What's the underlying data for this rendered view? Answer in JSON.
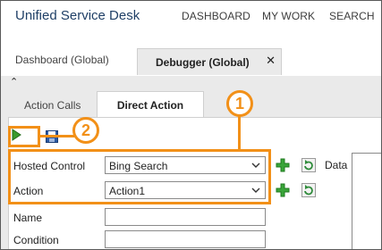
{
  "app": {
    "title": "Unified Service Desk"
  },
  "nav": {
    "items": [
      "DASHBOARD",
      "MY WORK",
      "SEARCH"
    ]
  },
  "session_tabs": [
    {
      "label": "Dashboard (Global)"
    },
    {
      "label": "Debugger (Global)",
      "close_glyph": "✕"
    }
  ],
  "debugger": {
    "collapse_glyph": "⌃",
    "tabs": [
      {
        "label": "Action Calls"
      },
      {
        "label": "Direct Action"
      }
    ]
  },
  "toolbar": {
    "run_icon": "play-icon",
    "save_icon": "save-icon"
  },
  "form": {
    "hosted_control": {
      "label": "Hosted Control",
      "value": "Bing Search"
    },
    "action": {
      "label": "Action",
      "value": "Action1"
    },
    "name": {
      "label": "Name",
      "value": ""
    },
    "condition": {
      "label": "Condition",
      "value": ""
    },
    "data": {
      "label": "Data",
      "value": ""
    }
  },
  "callouts": {
    "one": "1",
    "two": "2"
  },
  "colors": {
    "callout": "#f29018",
    "title": "#1f3f66",
    "panel_bg": "#eaeaea",
    "play_green": "#3a9b2e",
    "save_blue": "#2b5aa3"
  }
}
